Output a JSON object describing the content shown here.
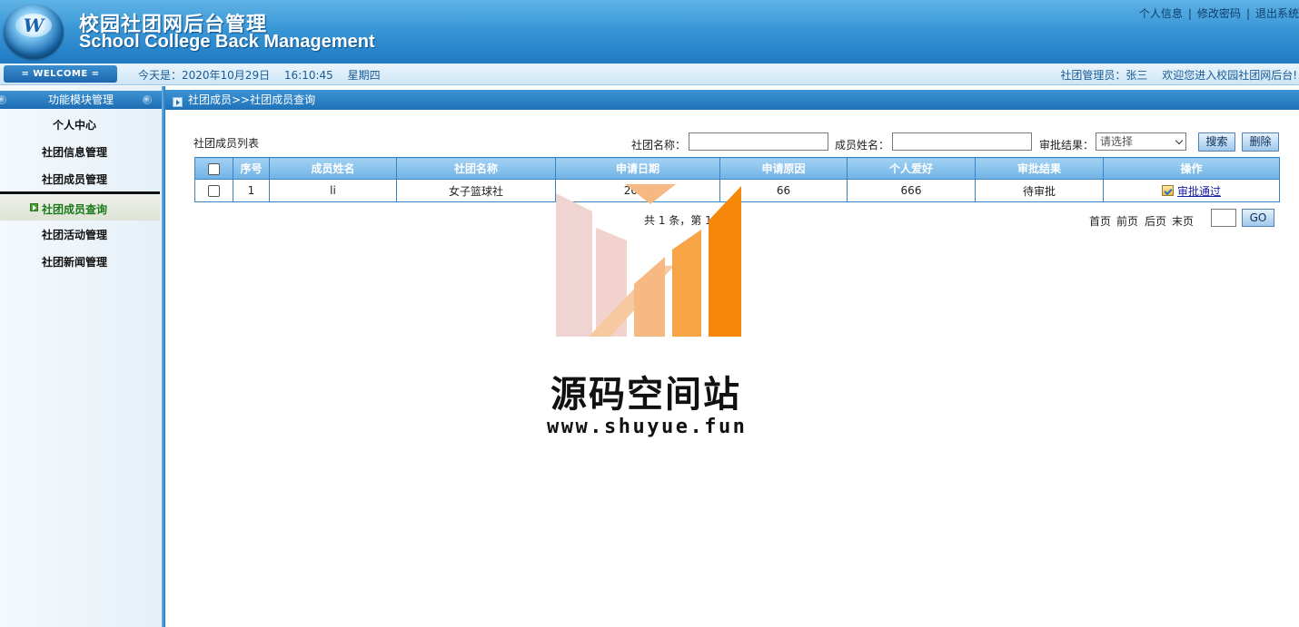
{
  "header": {
    "logo_letter": "W",
    "title_cn": "校园社团网后台管理",
    "title_en": "School College Back Management",
    "links": [
      "个人信息",
      "修改密码",
      "退出系统"
    ],
    "separator": "|"
  },
  "infobar": {
    "welcome": "= WELCOME =",
    "today_label": "今天是：2020年10月29日",
    "time": "16:10:45",
    "weekday": "星期四",
    "admin": "社团管理员：张三",
    "greeting": "欢迎您进入校园社团网后台!"
  },
  "sidebar": {
    "heading": "功能模块管理",
    "items": [
      {
        "label": "个人中心"
      },
      {
        "label": "社团信息管理"
      },
      {
        "label": "社团成员管理"
      },
      {
        "label": "社团成员查询",
        "active": true
      },
      {
        "label": "社团活动管理"
      },
      {
        "label": "社团新闻管理"
      }
    ]
  },
  "breadcrumb": "社团成员>>社团成员查询",
  "list": {
    "title": "社团成员列表",
    "filters": {
      "club_name_label": "社团名称：",
      "club_name_value": "",
      "member_name_label": "成员姓名：",
      "member_name_value": "",
      "result_label": "审批结果：",
      "result_selected": "请选择"
    },
    "search_button": "搜索",
    "delete_button": "删除",
    "columns": [
      "序号",
      "成员姓名",
      "社团名称",
      "申请日期",
      "申请原因",
      "个人爱好",
      "审批结果",
      "操作"
    ],
    "rows": [
      {
        "index": "1",
        "member": "li",
        "club": "女子篮球社",
        "date": "2020",
        "reason": "66",
        "hobby": "666",
        "result": "待审批",
        "action": "审批通过"
      }
    ],
    "summary": "共 1 条，第 1/",
    "pager": {
      "first": "首页",
      "prev": "前页",
      "next": "后页",
      "last": "末页",
      "go": "GO",
      "page_value": ""
    }
  },
  "watermark": {
    "name": "源码空间站",
    "url": "www.shuyue.fun"
  },
  "colors": {
    "header_blue": "#1f7ac3",
    "watermark_orange": "#f5870a",
    "watermark_pink": "#efd4d2",
    "active_green": "#1a7a1a"
  }
}
